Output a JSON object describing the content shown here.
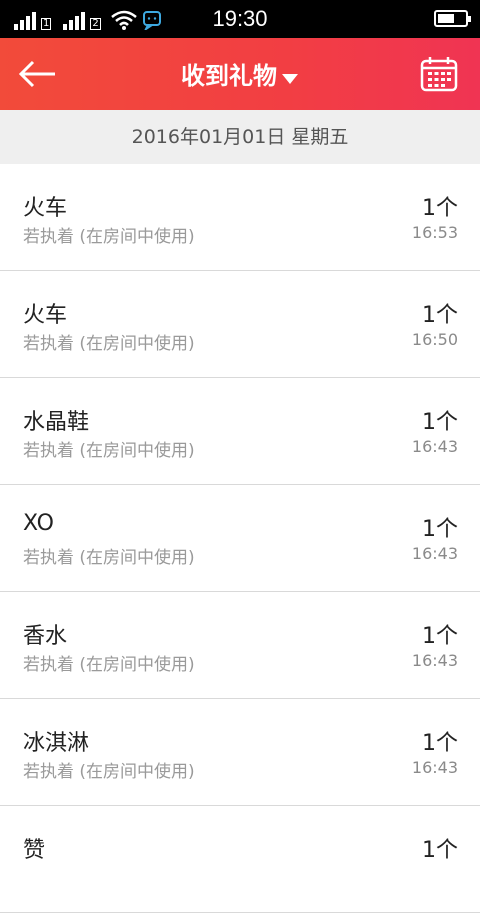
{
  "status_bar": {
    "time": "19:30",
    "sim1_label": "1",
    "sim2_label": "2"
  },
  "header": {
    "title": "收到礼物",
    "back_icon": "back-arrow-icon",
    "calendar_icon": "calendar-icon",
    "accent_color": "#f2403f"
  },
  "date_header": "2016年01月01日 星期五",
  "gifts": [
    {
      "name": "火车",
      "desc": "若执着 (在房间中使用)",
      "count": "1个",
      "time": "16:53"
    },
    {
      "name": "火车",
      "desc": "若执着 (在房间中使用)",
      "count": "1个",
      "time": "16:50"
    },
    {
      "name": "水晶鞋",
      "desc": "若执着 (在房间中使用)",
      "count": "1个",
      "time": "16:43"
    },
    {
      "name": "XO",
      "desc": "若执着 (在房间中使用)",
      "count": "1个",
      "time": "16:43"
    },
    {
      "name": "香水",
      "desc": "若执着 (在房间中使用)",
      "count": "1个",
      "time": "16:43"
    },
    {
      "name": "冰淇淋",
      "desc": "若执着 (在房间中使用)",
      "count": "1个",
      "time": "16:43"
    },
    {
      "name": "赞",
      "desc": "",
      "count": "1个",
      "time": ""
    }
  ]
}
